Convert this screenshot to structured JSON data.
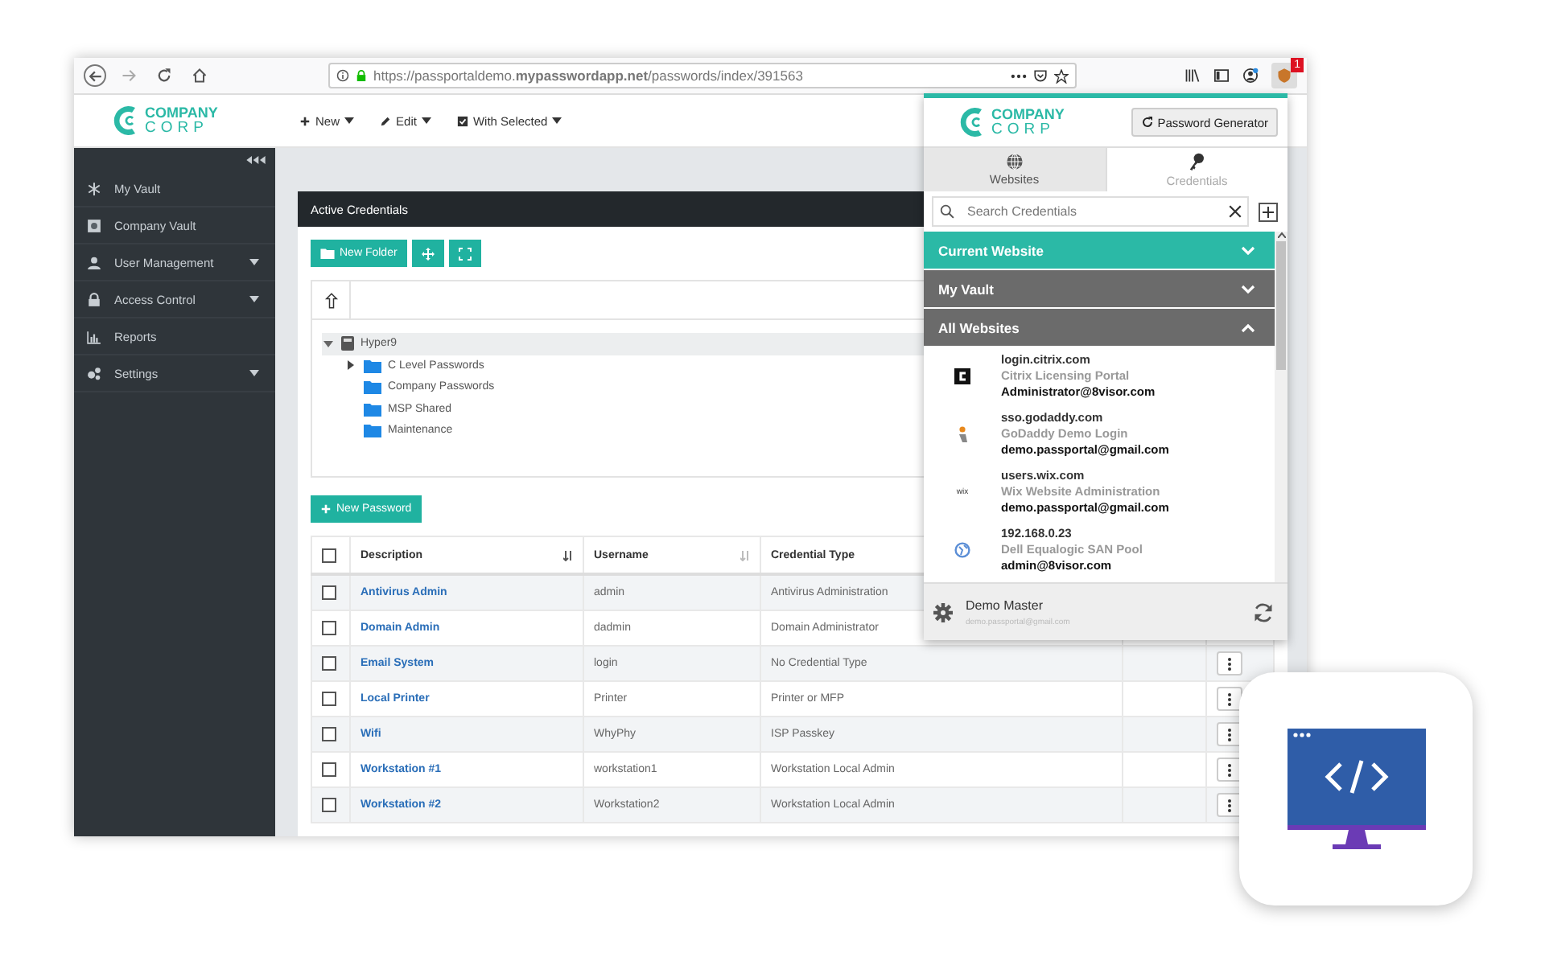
{
  "browser": {
    "url": "https://passportaldemo.**mypasswordapp.net**/passwords/index/391563",
    "extension_badge": "1"
  },
  "app": {
    "logo": {
      "top": "COMPANY",
      "bottom": "CORP"
    },
    "toolbar": [
      {
        "label": "New"
      },
      {
        "label": "Edit"
      },
      {
        "label": "With Selected"
      }
    ],
    "sidebar": [
      {
        "label": "My Vault",
        "expandable": false
      },
      {
        "label": "Company Vault",
        "expandable": false
      },
      {
        "label": "User Management",
        "expandable": true
      },
      {
        "label": "Access Control",
        "expandable": true
      },
      {
        "label": "Reports",
        "expandable": false
      },
      {
        "label": "Settings",
        "expandable": true
      }
    ],
    "panel": {
      "title": "Active Credentials",
      "new_folder": "New Folder",
      "tree": {
        "label": "Hyper9",
        "expanded": true,
        "selected": true,
        "children": [
          {
            "label": "C Level Passwords",
            "expandable": true,
            "expanded": false
          },
          {
            "label": "Company Passwords",
            "expandable": false
          },
          {
            "label": "MSP Shared",
            "expandable": false
          },
          {
            "label": "Maintenance",
            "expandable": false
          }
        ]
      },
      "new_password": "New Password",
      "columns": [
        "Description",
        "Username",
        "Credential Type"
      ],
      "all_checked": false,
      "rows": [
        {
          "description": "Antivirus Admin",
          "username": "admin",
          "type": "Antivirus Administration",
          "menu": false,
          "checked": false
        },
        {
          "description": "Domain Admin",
          "username": "dadmin",
          "type": "Domain Administrator",
          "menu": false,
          "checked": false
        },
        {
          "description": "Email System",
          "username": "login",
          "type": "No Credential Type",
          "menu": true,
          "checked": false
        },
        {
          "description": "Local Printer",
          "username": "Printer",
          "type": "Printer or MFP",
          "menu": true,
          "checked": false
        },
        {
          "description": "Wifi",
          "username": "WhyPhy",
          "type": "ISP Passkey",
          "menu": true,
          "checked": false
        },
        {
          "description": "Workstation #1",
          "username": "workstation1",
          "type": "Workstation Local Admin",
          "menu": true,
          "checked": false
        },
        {
          "description": "Workstation #2",
          "username": "Workstation2",
          "type": "Workstation Local Admin",
          "menu": true,
          "checked": false
        }
      ]
    }
  },
  "popup": {
    "logo": {
      "top": "COMPANY",
      "bottom": "CORP"
    },
    "generator_button": "Password Generator",
    "tabs": [
      {
        "label": "Websites",
        "selected": true
      },
      {
        "label": "Credentials",
        "selected": false
      }
    ],
    "search": {
      "placeholder": "Search Credentials"
    },
    "sections": [
      {
        "title": "Current Website",
        "expanded": false,
        "color": "#2bb9a6"
      },
      {
        "title": "My Vault",
        "expanded": false,
        "color": "#6b6b6b"
      },
      {
        "title": "All Websites",
        "expanded": true,
        "color": "#6b6b6b"
      }
    ],
    "entries": [
      {
        "host": "login.citrix.com",
        "title": "Citrix Licensing Portal",
        "username": "Administrator@8visor.com"
      },
      {
        "host": "sso.godaddy.com",
        "title": "GoDaddy Demo Login",
        "username": "demo.passportal@gmail.com"
      },
      {
        "host": "users.wix.com",
        "title": "Wix Website Administration",
        "username": "demo.passportal@gmail.com",
        "logo_text": "wix"
      },
      {
        "host": "192.168.0.23",
        "title": "Dell Equalogic SAN Pool",
        "username": "admin@8visor.com"
      }
    ],
    "footer": {
      "name": "Demo Master",
      "email": "demo.passportal@gmail.com"
    }
  }
}
